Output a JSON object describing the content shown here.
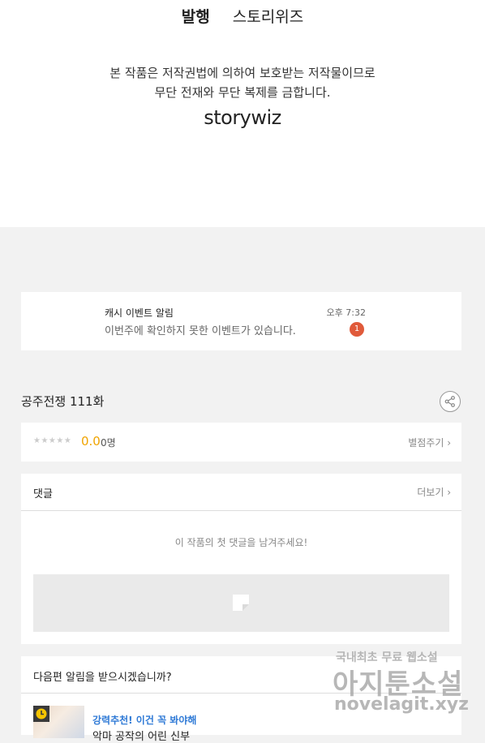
{
  "publisher": {
    "label": "발행",
    "name": "스토리위즈"
  },
  "copyright": {
    "line1": "본 작품은 저작권법에 의하여 보호받는 저작물이므로",
    "line2": "무단 전재와 무단 복제를 금합니다.",
    "logo": "storywiz"
  },
  "notification": {
    "title": "캐시 이벤트 알림",
    "message": "이번주에 확인하지 못한 이벤트가 있습니다.",
    "time": "오후 7:32",
    "badge": "1"
  },
  "episode": {
    "title": "공주전쟁 111화",
    "share_icon": "share-icon"
  },
  "rating": {
    "stars": "★★★★★",
    "score": "0.0",
    "count": "0명",
    "rate_button": "별점주기 ›"
  },
  "comments": {
    "header": "댓글",
    "more": "더보기 ›",
    "empty_message": "이 작품의 첫 댓글을 남겨주세요!"
  },
  "next_episode": {
    "question": "다음편 알림을 받으시겠습니까?",
    "recommend_label": "강력추천! 이건 꼭 봐야해",
    "recommend_title": "악마 공작의 어린 신부"
  },
  "watermark": {
    "line1": "국내최초 무료 웹소설",
    "line2": "아지툰소설",
    "line3": "novelagit.xyz"
  },
  "colors": {
    "accent_orange": "#f0a400",
    "badge_red": "#e05a3a",
    "link_blue": "#2f7ad6"
  }
}
